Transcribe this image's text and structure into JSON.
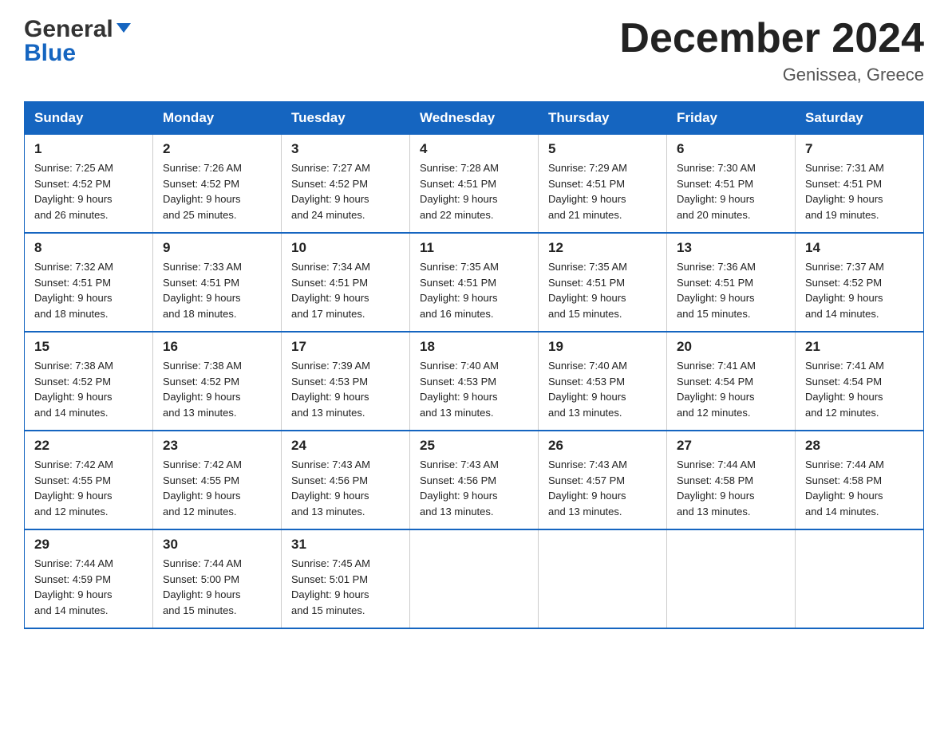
{
  "header": {
    "logo_general": "General",
    "logo_blue": "Blue",
    "month_title": "December 2024",
    "location": "Genissea, Greece"
  },
  "days_of_week": [
    "Sunday",
    "Monday",
    "Tuesday",
    "Wednesday",
    "Thursday",
    "Friday",
    "Saturday"
  ],
  "weeks": [
    [
      {
        "day": "1",
        "sunrise": "7:25 AM",
        "sunset": "4:52 PM",
        "daylight": "9 hours and 26 minutes."
      },
      {
        "day": "2",
        "sunrise": "7:26 AM",
        "sunset": "4:52 PM",
        "daylight": "9 hours and 25 minutes."
      },
      {
        "day": "3",
        "sunrise": "7:27 AM",
        "sunset": "4:52 PM",
        "daylight": "9 hours and 24 minutes."
      },
      {
        "day": "4",
        "sunrise": "7:28 AM",
        "sunset": "4:51 PM",
        "daylight": "9 hours and 22 minutes."
      },
      {
        "day": "5",
        "sunrise": "7:29 AM",
        "sunset": "4:51 PM",
        "daylight": "9 hours and 21 minutes."
      },
      {
        "day": "6",
        "sunrise": "7:30 AM",
        "sunset": "4:51 PM",
        "daylight": "9 hours and 20 minutes."
      },
      {
        "day": "7",
        "sunrise": "7:31 AM",
        "sunset": "4:51 PM",
        "daylight": "9 hours and 19 minutes."
      }
    ],
    [
      {
        "day": "8",
        "sunrise": "7:32 AM",
        "sunset": "4:51 PM",
        "daylight": "9 hours and 18 minutes."
      },
      {
        "day": "9",
        "sunrise": "7:33 AM",
        "sunset": "4:51 PM",
        "daylight": "9 hours and 18 minutes."
      },
      {
        "day": "10",
        "sunrise": "7:34 AM",
        "sunset": "4:51 PM",
        "daylight": "9 hours and 17 minutes."
      },
      {
        "day": "11",
        "sunrise": "7:35 AM",
        "sunset": "4:51 PM",
        "daylight": "9 hours and 16 minutes."
      },
      {
        "day": "12",
        "sunrise": "7:35 AM",
        "sunset": "4:51 PM",
        "daylight": "9 hours and 15 minutes."
      },
      {
        "day": "13",
        "sunrise": "7:36 AM",
        "sunset": "4:51 PM",
        "daylight": "9 hours and 15 minutes."
      },
      {
        "day": "14",
        "sunrise": "7:37 AM",
        "sunset": "4:52 PM",
        "daylight": "9 hours and 14 minutes."
      }
    ],
    [
      {
        "day": "15",
        "sunrise": "7:38 AM",
        "sunset": "4:52 PM",
        "daylight": "9 hours and 14 minutes."
      },
      {
        "day": "16",
        "sunrise": "7:38 AM",
        "sunset": "4:52 PM",
        "daylight": "9 hours and 13 minutes."
      },
      {
        "day": "17",
        "sunrise": "7:39 AM",
        "sunset": "4:53 PM",
        "daylight": "9 hours and 13 minutes."
      },
      {
        "day": "18",
        "sunrise": "7:40 AM",
        "sunset": "4:53 PM",
        "daylight": "9 hours and 13 minutes."
      },
      {
        "day": "19",
        "sunrise": "7:40 AM",
        "sunset": "4:53 PM",
        "daylight": "9 hours and 13 minutes."
      },
      {
        "day": "20",
        "sunrise": "7:41 AM",
        "sunset": "4:54 PM",
        "daylight": "9 hours and 12 minutes."
      },
      {
        "day": "21",
        "sunrise": "7:41 AM",
        "sunset": "4:54 PM",
        "daylight": "9 hours and 12 minutes."
      }
    ],
    [
      {
        "day": "22",
        "sunrise": "7:42 AM",
        "sunset": "4:55 PM",
        "daylight": "9 hours and 12 minutes."
      },
      {
        "day": "23",
        "sunrise": "7:42 AM",
        "sunset": "4:55 PM",
        "daylight": "9 hours and 12 minutes."
      },
      {
        "day": "24",
        "sunrise": "7:43 AM",
        "sunset": "4:56 PM",
        "daylight": "9 hours and 13 minutes."
      },
      {
        "day": "25",
        "sunrise": "7:43 AM",
        "sunset": "4:56 PM",
        "daylight": "9 hours and 13 minutes."
      },
      {
        "day": "26",
        "sunrise": "7:43 AM",
        "sunset": "4:57 PM",
        "daylight": "9 hours and 13 minutes."
      },
      {
        "day": "27",
        "sunrise": "7:44 AM",
        "sunset": "4:58 PM",
        "daylight": "9 hours and 13 minutes."
      },
      {
        "day": "28",
        "sunrise": "7:44 AM",
        "sunset": "4:58 PM",
        "daylight": "9 hours and 14 minutes."
      }
    ],
    [
      {
        "day": "29",
        "sunrise": "7:44 AM",
        "sunset": "4:59 PM",
        "daylight": "9 hours and 14 minutes."
      },
      {
        "day": "30",
        "sunrise": "7:44 AM",
        "sunset": "5:00 PM",
        "daylight": "9 hours and 15 minutes."
      },
      {
        "day": "31",
        "sunrise": "7:45 AM",
        "sunset": "5:01 PM",
        "daylight": "9 hours and 15 minutes."
      },
      null,
      null,
      null,
      null
    ]
  ],
  "labels": {
    "sunrise": "Sunrise:",
    "sunset": "Sunset:",
    "daylight": "Daylight:"
  }
}
